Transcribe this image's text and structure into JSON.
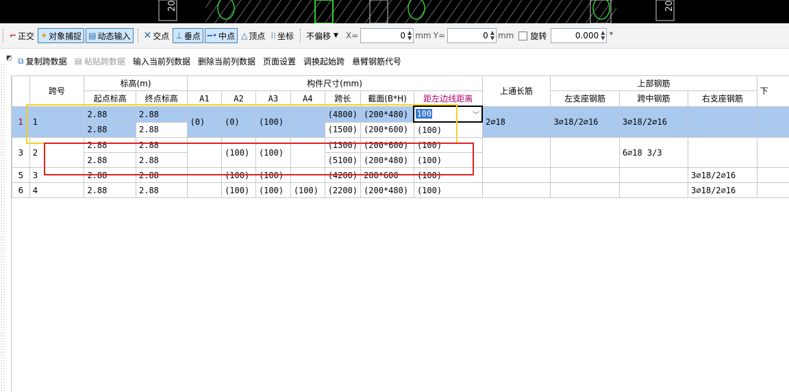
{
  "canvas": {
    "labels": [
      "20",
      "20"
    ]
  },
  "snap_toolbar": {
    "ortho": "正交",
    "snap": "对象捕捉",
    "dynamic_input": "动态输入",
    "intersection": "交点",
    "perpendicular": "垂点",
    "midpoint": "中点",
    "vertex": "顶点",
    "coordinate": "坐标",
    "offset_mode": "不偏移",
    "x_label": "X=",
    "x_value": "0",
    "x_unit": "mm",
    "y_label": "Y=",
    "y_value": "0",
    "y_unit": "mm",
    "rotate_label": "旋转",
    "rotate_value": "0.000",
    "rotate_unit": "°"
  },
  "grid_toolbar": {
    "copy_span": "复制跨数据",
    "paste_span": "粘贴跨数据",
    "input_col": "输入当前列数据",
    "delete_col": "删除当前列数据",
    "page_setup": "页面设置",
    "swap_start": "调换起始跨",
    "cantilever": "悬臂钢筋代号"
  },
  "headers": {
    "span_no": "跨号",
    "elevation": "标高(m)",
    "start_elev": "起点标高",
    "end_elev": "终点标高",
    "member_size": "构件尺寸(mm)",
    "a1": "A1",
    "a2": "A2",
    "a3": "A3",
    "a4": "A4",
    "span_len": "跨长",
    "section": "截面(B*H)",
    "left_edge": "距左边线距离",
    "top_through": "上通长筋",
    "top_rebar": "上部钢筋",
    "left_support": "左支座钢筋",
    "mid_span": "跨中钢筋",
    "right_support": "右支座钢筋",
    "bottom_partial": "下"
  },
  "rows": [
    {
      "rn": "1",
      "span": "1",
      "sub": [
        {
          "start": "2.88",
          "end": "2.88",
          "len": "(4800)",
          "sec": "(200*480)",
          "edge": "100"
        },
        {
          "start": "2.88",
          "end": "2.88",
          "len": "(1500)",
          "sec": "(200*600)",
          "edge": "(100)"
        }
      ],
      "a1": "(0)",
      "a2": "(0)",
      "a3": "(100)",
      "a4": "",
      "through": "2⌀18",
      "left": "3⌀18/2⌀16",
      "mid": "3⌀18/2⌀16",
      "right": ""
    },
    {
      "rn": "3",
      "span": "2",
      "sub": [
        {
          "start": "2.88",
          "end": "2.88",
          "len": "(1300)",
          "sec": "(200*600)",
          "edge": "(100)"
        },
        {
          "start": "2.88",
          "end": "2.88",
          "len": "(5100)",
          "sec": "(200*480)",
          "edge": "(100)"
        }
      ],
      "a1": "",
      "a2": "(100)",
      "a3": "(100)",
      "a4": "",
      "through": "",
      "left": "",
      "mid": "6⌀18 3/3",
      "right": ""
    },
    {
      "rn": "5",
      "span": "3",
      "start": "2.88",
      "end": "2.88",
      "a1": "",
      "a2": "(100)",
      "a3": "(100)",
      "a4": "",
      "len": "(4200)",
      "sec": "200*600",
      "edge": "(100)",
      "through": "",
      "left": "",
      "mid": "",
      "right": "3⌀18/2⌀16"
    },
    {
      "rn": "6",
      "span": "4",
      "start": "2.88",
      "end": "2.88",
      "a1": "",
      "a2": "(100)",
      "a3": "(100)",
      "a4": "(100)",
      "len": "(2200)",
      "sec": "(200*480)",
      "edge": "(100)",
      "through": "",
      "left": "",
      "mid": "",
      "right": "3⌀18/2⌀16"
    }
  ],
  "colors": {
    "selection": "#a9c9ef",
    "yellow_box": "#f2d12a",
    "red_box": "#e02020",
    "active_btn": "#cfe6fb"
  }
}
